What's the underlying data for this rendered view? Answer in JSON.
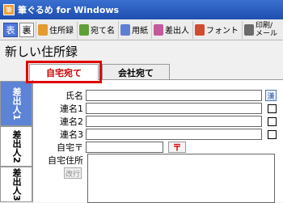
{
  "window": {
    "title": "筆ぐるめ for Windows",
    "app_icon": "筆"
  },
  "toolbar": {
    "front_label": "表",
    "back_label": "裏",
    "buttons": [
      {
        "label": "住所録",
        "icon": "addressbook-icon",
        "color": "#e49b2f"
      },
      {
        "label": "宛て名",
        "icon": "envelope-icon",
        "color": "#5f9f39"
      },
      {
        "label": "用紙",
        "icon": "paper-icon",
        "color": "#5f7fd0"
      },
      {
        "label": "差出人",
        "icon": "person-icon",
        "color": "#c25a9c"
      },
      {
        "label": "フォント",
        "icon": "font-icon",
        "color": "#d14b2f"
      },
      {
        "label": "印刷/メール",
        "icon": "print-icon",
        "color": "#6a6a6a"
      }
    ]
  },
  "page": {
    "heading": "新しい住所録"
  },
  "tabs": {
    "home": "自宅宛て",
    "company": "会社宛て"
  },
  "side_tabs": [
    "差出人1",
    "差出人2",
    "差出人3"
  ],
  "form": {
    "name_label": "氏名",
    "joint1_label": "連名1",
    "joint2_label": "連名2",
    "joint3_label": "連名3",
    "postal_label": "自宅〒",
    "address_label": "自宅住所",
    "kanji_button": "漢",
    "postal_button": "〒",
    "newline_button": "改行"
  },
  "colors": {
    "highlight": "#e00000",
    "active_tab": "#5c83d6",
    "title_bar": "#1f4fb0"
  }
}
